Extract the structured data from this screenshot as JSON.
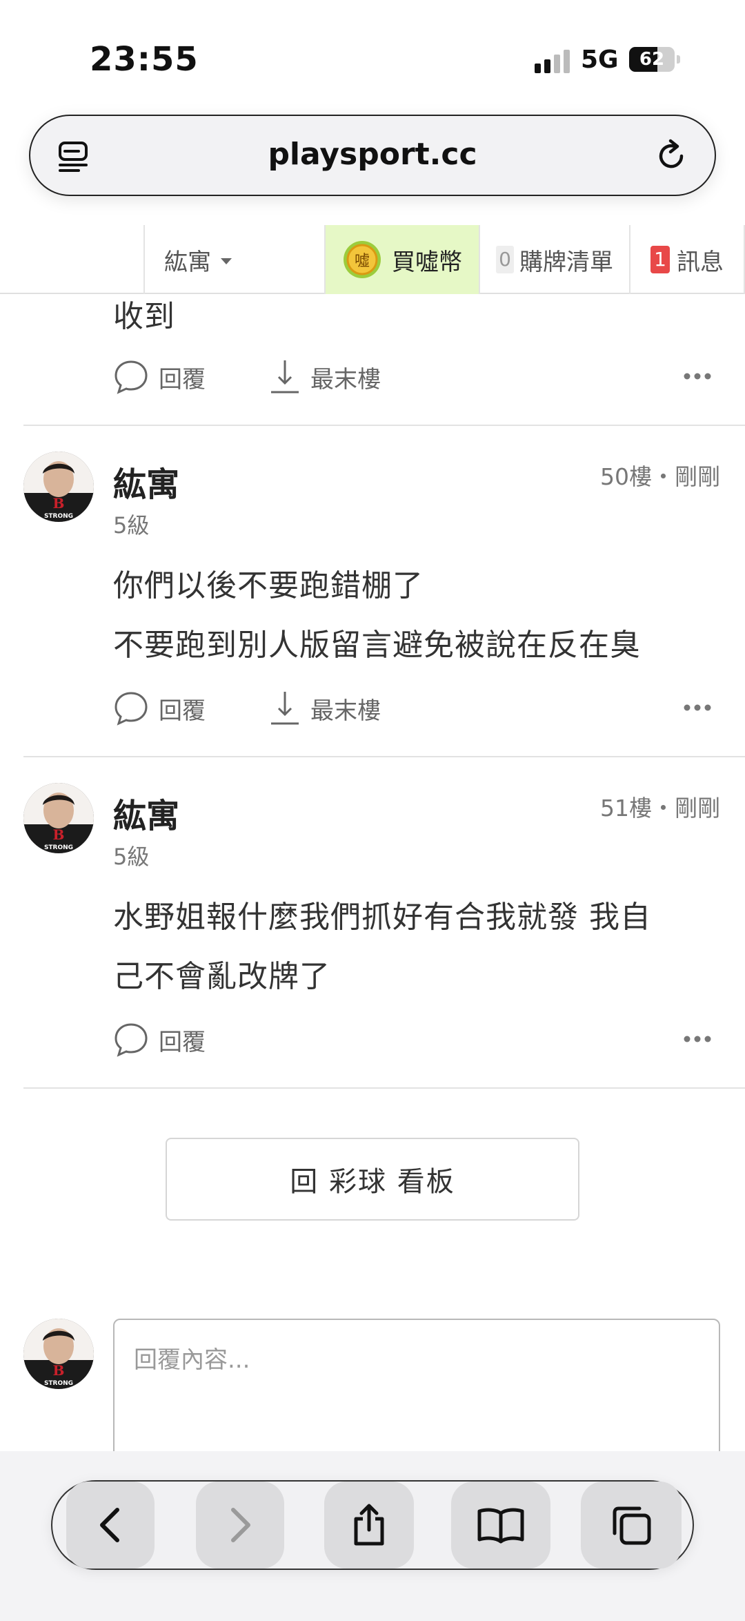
{
  "status_bar": {
    "time": "23:55",
    "network": "5G",
    "battery": "62",
    "battery_level": 0.62
  },
  "browser": {
    "url": "playsport.cc"
  },
  "site_nav": {
    "username": "紘寓",
    "coin_label": "買噓幣",
    "coin_icon_text": "噓",
    "cart_count": "0",
    "cart_label": "購牌清單",
    "messages_count": "1",
    "messages_label": "訊息"
  },
  "thread": {
    "partial_post": {
      "text": "收到",
      "reply_label": "回覆",
      "last_floor_label": "最末樓"
    },
    "posts": [
      {
        "author": "紘寓",
        "level": "5級",
        "meta": "50樓・剛剛",
        "lines": [
          "你們以後不要跑錯棚了",
          "不要跑到別人版留言避免被說在反在臭"
        ],
        "reply_label": "回覆",
        "last_floor_label": "最末樓"
      },
      {
        "author": "紘寓",
        "level": "5級",
        "meta": "51樓・剛剛",
        "lines": [
          "水野姐報什麼我們抓好有合我就發 我自",
          "己不會亂改牌了"
        ],
        "reply_label": "回覆"
      }
    ],
    "avatar_text": "STRONG",
    "back_button": "回 彩球 看板",
    "reply_placeholder": "回覆內容..."
  },
  "colors": {
    "coin_bg": "#e6f8c6",
    "badge_red": "#e84848",
    "text_main": "#333333",
    "text_muted": "#777777"
  }
}
